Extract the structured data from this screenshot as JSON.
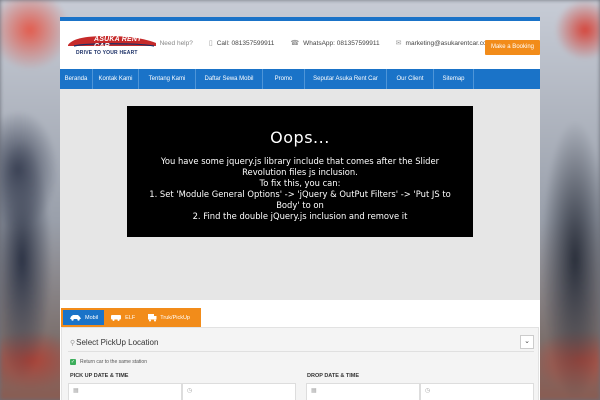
{
  "header": {
    "logo_text": "ASUKA RENT CAR",
    "logo_tagline": "DRIVE TO YOUR HEART",
    "need_help": "Need help?",
    "call": "Call: 081357599911",
    "whatsapp": "WhatsApp: 081357599911",
    "email": "marketing@asukarentcar.com",
    "book_button": "Make a Booking"
  },
  "nav": {
    "items": [
      {
        "label": "Beranda"
      },
      {
        "label": "Kontak Kami"
      },
      {
        "label": "Tentang Kami"
      },
      {
        "label": "Daftar Sewa Mobil"
      },
      {
        "label": "Promo"
      },
      {
        "label": "Seputar Asuka Rent Car"
      },
      {
        "label": "Our Client"
      },
      {
        "label": "Sitemap"
      }
    ]
  },
  "slider_error": {
    "title": "Oops...",
    "line1": "You have some jquery.js library include that comes after the Slider Revolution files js inclusion.",
    "line2": "To fix this, you can:",
    "line3": "1. Set 'Module General Options' -> 'jQuery & OutPut Filters' -> 'Put JS to Body' to on",
    "line4": "2. Find the double jQuery.js inclusion and remove it"
  },
  "booking": {
    "tabs": [
      {
        "label": "Mobil",
        "icon": "car-icon",
        "active": true
      },
      {
        "label": "ELF",
        "icon": "van-icon",
        "active": false
      },
      {
        "label": "Truk/PickUp",
        "icon": "truck-icon",
        "active": false
      }
    ],
    "location_label": "Select PickUp Location",
    "return_same": "Return car to the same station",
    "pickup_label": "PICK UP DATE & TIME",
    "drop_label": "DROP DATE & TIME"
  },
  "colors": {
    "primary": "#1a73c8",
    "accent": "#f28c1a",
    "check": "#3cae5b"
  }
}
